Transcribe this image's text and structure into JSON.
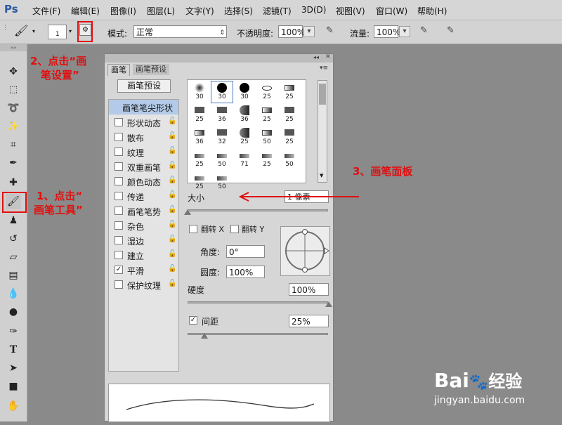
{
  "app": {
    "logo": "Ps"
  },
  "menu": [
    "文件(F)",
    "编辑(E)",
    "图像(I)",
    "图层(L)",
    "文字(Y)",
    "选择(S)",
    "滤镜(T)",
    "3D(D)",
    "视图(V)",
    "窗口(W)",
    "帮助(H)"
  ],
  "options": {
    "brush_size": "1",
    "mode_label": "模式:",
    "mode_value": "正常",
    "opacity_label": "不透明度:",
    "opacity_value": "100%",
    "flow_label": "流量:",
    "flow_value": "100%"
  },
  "panel": {
    "tabs": [
      "画笔",
      "画笔预设"
    ],
    "preset_button": "画笔预设",
    "tip_shape": "画笔笔尖形状",
    "options": [
      {
        "label": "形状动态",
        "checked": false
      },
      {
        "label": "散布",
        "checked": false
      },
      {
        "label": "纹理",
        "checked": false
      },
      {
        "label": "双重画笔",
        "checked": false
      },
      {
        "label": "颜色动态",
        "checked": false
      },
      {
        "label": "传递",
        "checked": false
      },
      {
        "label": "画笔笔势",
        "checked": false
      },
      {
        "label": "杂色",
        "checked": false
      },
      {
        "label": "湿边",
        "checked": false
      },
      {
        "label": "建立",
        "checked": false
      },
      {
        "label": "平滑",
        "checked": true
      },
      {
        "label": "保护纹理",
        "checked": false
      }
    ],
    "tip_sizes": [
      "30",
      "30",
      "30",
      "25",
      "25",
      "25",
      "36",
      "36",
      "25",
      "25",
      "36",
      "32",
      "25",
      "50",
      "25",
      "25",
      "50",
      "71",
      "25",
      "50",
      "25",
      "50"
    ],
    "size_label": "大小",
    "size_value": "1 像素",
    "flip_x_label": "翻转 X",
    "flip_y_label": "翻转 Y",
    "angle_label": "角度:",
    "angle_value": "0°",
    "roundness_label": "圆度:",
    "roundness_value": "100%",
    "hardness_label": "硬度",
    "hardness_value": "100%",
    "spacing_label": "间距",
    "spacing_value": "25%",
    "spacing_checked": true
  },
  "annotations": {
    "step1": "1、点击“",
    "step1b": "画笔工具”",
    "step2": "2、点击“画",
    "step2b": "笔设置”",
    "step3": "3、画笔面板"
  },
  "watermark": {
    "brand": "Bai",
    "brand2": "经验",
    "url": "jingyan.baidu.com"
  },
  "colors": {
    "annotation_red": "#e01010",
    "panel_bg": "#d6d6d6",
    "canvas_bg": "#8a8a8a"
  }
}
